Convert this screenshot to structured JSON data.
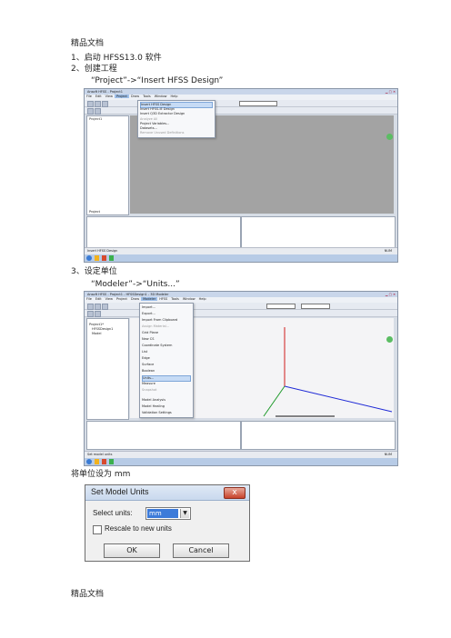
{
  "doc": {
    "header": "精品文档",
    "footer": "精品文档",
    "steps": [
      {
        "num": "1、",
        "text": "启动 HFSS13.0 软件"
      },
      {
        "num": "2、",
        "text": "创建工程"
      },
      {
        "num": "3、",
        "text": "设定单位"
      }
    ],
    "step2_path": "“Project”->“Insert HFSS Design”",
    "step3_path": "“Modeler”->“Units...”",
    "set_units_note": "将单位设为 mm"
  },
  "shot1": {
    "title": "Ansoft HFSS - Project1",
    "menu": [
      "File",
      "Edit",
      "View",
      "Project",
      "Draw",
      "Tools",
      "Window",
      "Help"
    ],
    "dropdown": [
      "Insert HFSS Design",
      "Insert HFSS-IE Design",
      "Insert Q3D Extractor Design",
      "Analyze All",
      "Project Variables...",
      "Datasets...",
      "Remove Unused Definitions"
    ],
    "tree_root": "Project1",
    "panel_label": "Project",
    "status": "Insert HFSS Design",
    "status_right": "NUM"
  },
  "shot2": {
    "title": "Ansoft HFSS - Project1 - HFSSDesign1 - 3D Modeler",
    "menu": [
      "File",
      "Edit",
      "View",
      "Project",
      "Draw",
      "Modeler",
      "HFSS",
      "Tools",
      "Window",
      "Help"
    ],
    "dropdown": [
      "Import...",
      "Export...",
      "Import From Clipboard",
      "Assign Material...",
      "Grid Plane",
      "New CS",
      "Coordinate System",
      "List",
      "Edge",
      "Surface",
      "Boolean",
      "Units...",
      "Measure",
      "Snapshot",
      "Model Analysis",
      "Model Healing",
      "Validation Settings"
    ],
    "tree_root": "Project1*",
    "tree_items": [
      "HFSSDesign1",
      "Model"
    ],
    "scale": [
      "0",
      "50",
      "100 (mm)"
    ],
    "status": "Set model units",
    "status_right": "NUM"
  },
  "dialog": {
    "title": "Set Model Units",
    "select_label": "Select units:",
    "select_value": "mm",
    "checkbox_label": "Rescale to new units",
    "ok": "OK",
    "cancel": "Cancel",
    "close": "x"
  }
}
